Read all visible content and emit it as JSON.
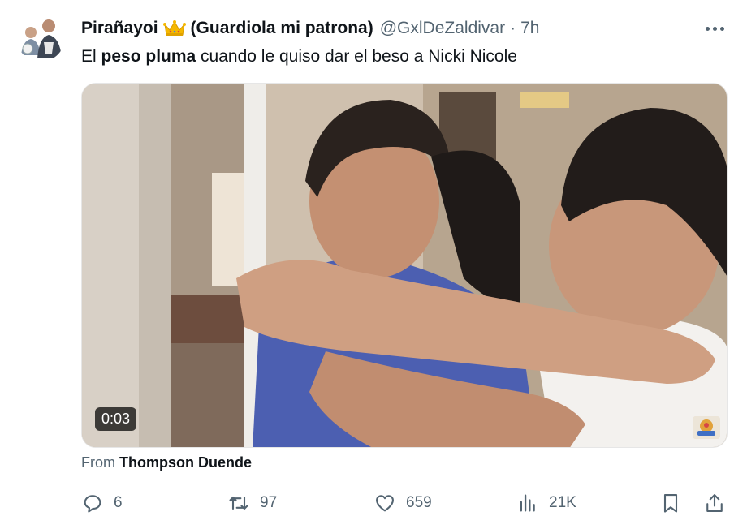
{
  "author": {
    "display_name": "Pirañayoi",
    "display_name_suffix": "(Guardiola mi patrona)",
    "handle": "@GxlDeZaldivar",
    "separator": "·",
    "time": "7h"
  },
  "tweet": {
    "text_parts": [
      "El ",
      "peso pluma",
      " cuando le quiso dar el beso a Nicki Nicole"
    ]
  },
  "media": {
    "duration": "0:03"
  },
  "attribution": {
    "prefix": "From ",
    "source": "Thompson Duende"
  },
  "actions": {
    "replies": "6",
    "reposts": "97",
    "likes": "659",
    "views": "21K"
  },
  "icons": {
    "crown": "crown-emoji-icon",
    "more": "more-dots-icon",
    "reply": "reply-icon",
    "repost": "repost-icon",
    "like": "heart-icon",
    "views": "views-chart-icon",
    "bookmark": "bookmark-icon",
    "share": "share-icon"
  },
  "colors": {
    "text_primary": "#0f1419",
    "text_secondary": "#536471",
    "crown": "#f5b800"
  }
}
